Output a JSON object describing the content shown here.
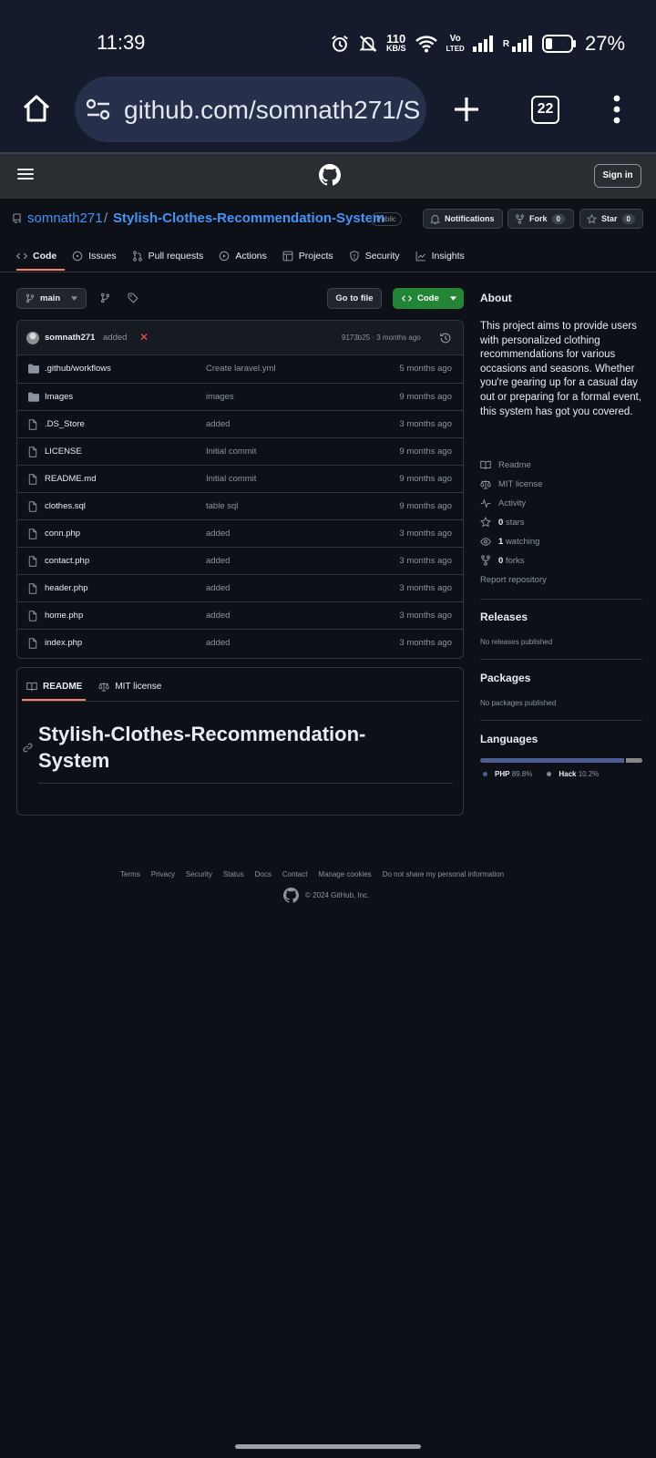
{
  "status_bar": {
    "time": "11:39",
    "net_speed_value": "110",
    "net_speed_unit": "KB/S",
    "volte_top": "Vo",
    "volte_bottom": "LTED",
    "roaming": "R",
    "battery_percent": "27%",
    "battery_level": 0.27
  },
  "browser": {
    "url": "github.com/somnath271/S",
    "tab_count": "22"
  },
  "gh_header": {
    "signin_label": "Sign in"
  },
  "repo": {
    "owner": "somnath271",
    "separator": "/",
    "name": "Stylish-Clothes-Recommendation-System",
    "visibility": "Public",
    "notifications_label": "Notifications",
    "fork_label": "Fork",
    "fork_count": "0",
    "star_label": "Star",
    "star_count": "0"
  },
  "tabs": [
    {
      "label": "Code",
      "icon": "code-icon"
    },
    {
      "label": "Issues",
      "icon": "issue-icon"
    },
    {
      "label": "Pull requests",
      "icon": "pull-request-icon"
    },
    {
      "label": "Actions",
      "icon": "play-icon"
    },
    {
      "label": "Projects",
      "icon": "table-icon"
    },
    {
      "label": "Security",
      "icon": "shield-icon"
    },
    {
      "label": "Insights",
      "icon": "graph-icon"
    }
  ],
  "toolbar": {
    "branch": "main",
    "goto_file": "Go to file",
    "code_button": "Code"
  },
  "latest_commit": {
    "author": "somnath271",
    "message": "added",
    "meta": "9173b25 · 3 months ago"
  },
  "files": [
    {
      "name": ".github/workflows",
      "type": "folder",
      "commit": "Create laravel.yml",
      "age": "5 months ago"
    },
    {
      "name": "Images",
      "type": "folder",
      "commit": "images",
      "age": "9 months ago"
    },
    {
      "name": ".DS_Store",
      "type": "file",
      "commit": "added",
      "age": "3 months ago"
    },
    {
      "name": "LICENSE",
      "type": "file",
      "commit": "Initial commit",
      "age": "9 months ago"
    },
    {
      "name": "README.md",
      "type": "file",
      "commit": "Initial commit",
      "age": "9 months ago"
    },
    {
      "name": "clothes.sql",
      "type": "file",
      "commit": "table sql",
      "age": "9 months ago"
    },
    {
      "name": "conn.php",
      "type": "file",
      "commit": "added",
      "age": "3 months ago"
    },
    {
      "name": "contact.php",
      "type": "file",
      "commit": "added",
      "age": "3 months ago"
    },
    {
      "name": "header.php",
      "type": "file",
      "commit": "added",
      "age": "3 months ago"
    },
    {
      "name": "home.php",
      "type": "file",
      "commit": "added",
      "age": "3 months ago"
    },
    {
      "name": "index.php",
      "type": "file",
      "commit": "added",
      "age": "3 months ago"
    }
  ],
  "readme": {
    "tab_readme": "README",
    "tab_license": "MIT license",
    "title": "Stylish-Clothes-Recommendation-System"
  },
  "about": {
    "heading": "About",
    "description": "This project aims to provide users with personalized clothing recommendations for various occasions and seasons. Whether you're gearing up for a casual day out or preparing for a formal event, this system has got you covered.",
    "readme": "Readme",
    "license": "MIT license",
    "activity": "Activity",
    "stars_count": "0",
    "stars_label": "stars",
    "watching_count": "1",
    "watching_label": "watching",
    "forks_count": "0",
    "forks_label": "forks",
    "report": "Report repository"
  },
  "releases": {
    "heading": "Releases",
    "empty": "No releases published"
  },
  "packages": {
    "heading": "Packages",
    "empty": "No packages published"
  },
  "languages": {
    "heading": "Languages",
    "items": [
      {
        "name": "PHP",
        "percent": "89.8%",
        "value": 89.8,
        "color": "#4F5D95"
      },
      {
        "name": "Hack",
        "percent": "10.2%",
        "value": 10.2,
        "color": "#878787"
      }
    ]
  },
  "footer": {
    "links": [
      "Terms",
      "Privacy",
      "Security",
      "Status",
      "Docs",
      "Contact",
      "Manage cookies",
      "Do not share my personal information"
    ],
    "copyright": "© 2024 GitHub, Inc."
  },
  "colors": {
    "accent_link": "#4493f8",
    "green_button": "#238636",
    "tab_underline": "#f78166",
    "background": "#0d1117"
  }
}
